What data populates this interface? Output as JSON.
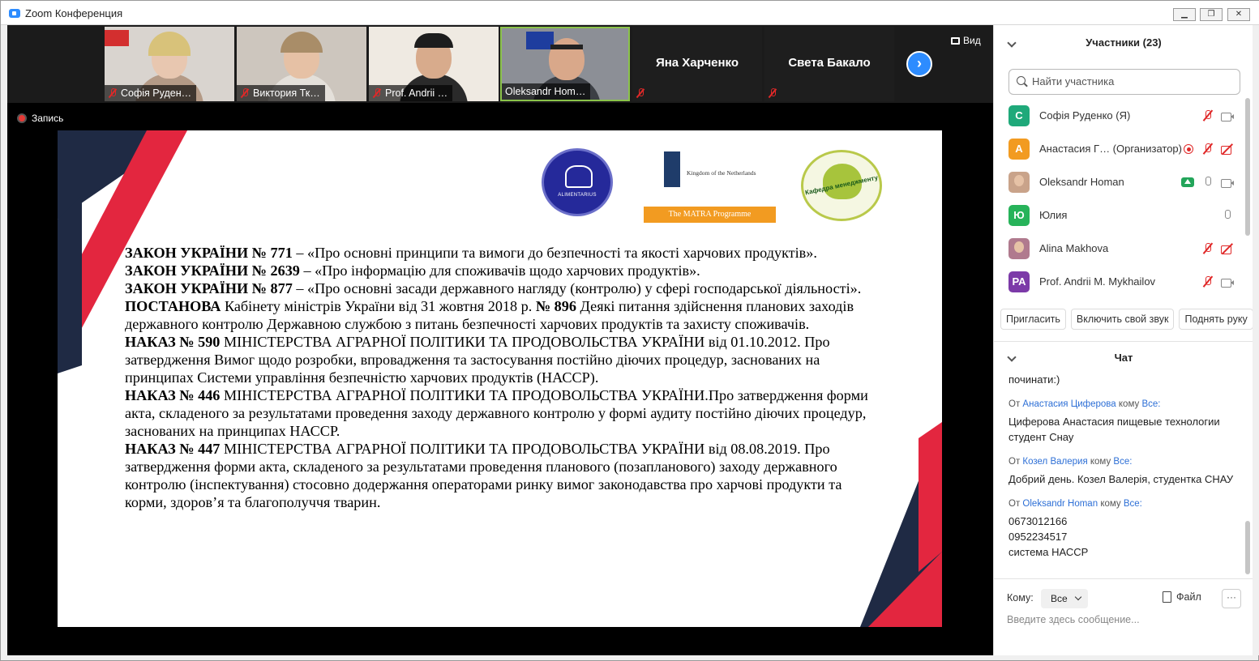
{
  "window": {
    "title": "Zoom Конференция",
    "min": "▁",
    "max": "❐",
    "close": "✕"
  },
  "gallery": {
    "tiles": [
      {
        "name": "Софія Руден…"
      },
      {
        "name": "Виктория Тк…"
      },
      {
        "name": "Prof. Andrii …"
      },
      {
        "name": "Oleksandr Hom…"
      }
    ],
    "text_tiles": [
      {
        "name": "Яна Харченко"
      },
      {
        "name": "Света Бакало"
      }
    ],
    "next": "›",
    "view_label": "Вид"
  },
  "recording": {
    "label": "Запись"
  },
  "slide": {
    "logos": {
      "alimentarius": "ALIMENTARIUS",
      "netherlands": "Kingdom of the Netherlands",
      "matra": "The MATRA Programme",
      "kafedra": "Кафедра менеджменту"
    },
    "p1_bold": "ЗАКОН УКРАЇНИ № 771",
    "p1_rest": " – «Про основні принципи та вимоги до безпечності та якості харчових продуктів».",
    "p2_bold": "ЗАКОН УКРАЇНИ № 2639",
    "p2_rest": " – «Про інформацію для споживачів щодо харчових продуктів».",
    "p3_bold": "ЗАКОН УКРАЇНИ № 877",
    "p3_rest": " – «Про основні засади державного нагляду (контролю) у сфері господарської діяльності».",
    "p4_bold": "ПОСТАНОВА",
    "p4_mid": " Кабінету міністрів України від 31 жовтня 2018 р. ",
    "p4_bold2": "№ 896",
    "p4_rest": " Деякі питання здійснення планових заходів державного контролю Державною службою з питань безпечності харчових продуктів та захисту споживачів.",
    "p5_bold": "НАКАЗ  № 590",
    "p5_rest": " МІНІСТЕРСТВА АГРАРНОЇ ПОЛІТИКИ ТА ПРОДОВОЛЬСТВА УКРАЇНИ від 01.10.2012. Про затвердження Вимог щодо розробки, впровадження та застосування постійно діючих процедур, заснованих на принципах Системи управління безпечністю харчових продуктів (НАССР).",
    "p6_bold": "НАКАЗ № 446",
    "p6_rest": " МІНІСТЕРСТВА АГРАРНОЇ ПОЛІТИКИ ТА ПРОДОВОЛЬСТВА УКРАЇНИ.Про затвердження форми акта, складеного за результатами проведення заходу державного контролю у формі аудиту постійно діючих процедур, заснованих на принципах НАССР.",
    "p7_bold": "НАКАЗ № 447",
    "p7_rest": " МІНІСТЕРСТВА АГРАРНОЇ ПОЛІТИКИ ТА ПРОДОВОЛЬСТВА УКРАЇНИ від 08.08.2019. Про затвердження форми акта, складеного за результатами проведення планового (позапланового) заходу державного контролю (інспектування) стосовно додержання операторами ринку вимог законодавства про харчові продукти та корми, здоров’я та благополуччя тварин."
  },
  "participants": {
    "title": "Участники (23)",
    "search_placeholder": "Найти участника",
    "list": [
      {
        "initial": "С",
        "name": "Софія Руденко (Я)",
        "color": "#1fa97a"
      },
      {
        "initial": "А",
        "name": "Анастасия Г…  (Организатор)",
        "color": "#f29b21"
      },
      {
        "initial": "",
        "name": "Oleksandr Homan",
        "color": "#c9a38a"
      },
      {
        "initial": "Ю",
        "name": "Юлия",
        "color": "#27b35a"
      },
      {
        "initial": "",
        "name": "Alina Makhova",
        "color": "#b07a8e"
      },
      {
        "initial": "PA",
        "name": "Prof. Andrii M. Mykhailov",
        "color": "#7c3aa8"
      }
    ],
    "invite": "Пригласить",
    "unmute": "Включить свой звук",
    "raise_hand": "Поднять руку"
  },
  "chat": {
    "title": "Чат",
    "partial": "починати:)",
    "messages": [
      {
        "from": "Анастасия Циферова",
        "to": "Все:",
        "text": "Циферова  Анастасия  пищевые технологии студент Снау"
      },
      {
        "from": "Козел Валерия",
        "to": "Все:",
        "text": "Добрий день. Козел Валерія, студентка СНАУ"
      },
      {
        "from": "Oleksandr Homan",
        "to": "Все:",
        "text": "0673012166\n0952234517\nсистема НАССР"
      }
    ],
    "from_label": "От",
    "to_word": "кому",
    "to_label": "Кому:",
    "to_value": "Все",
    "file": "Файл",
    "more": "···",
    "input_placeholder": "Введите здесь сообщение..."
  }
}
